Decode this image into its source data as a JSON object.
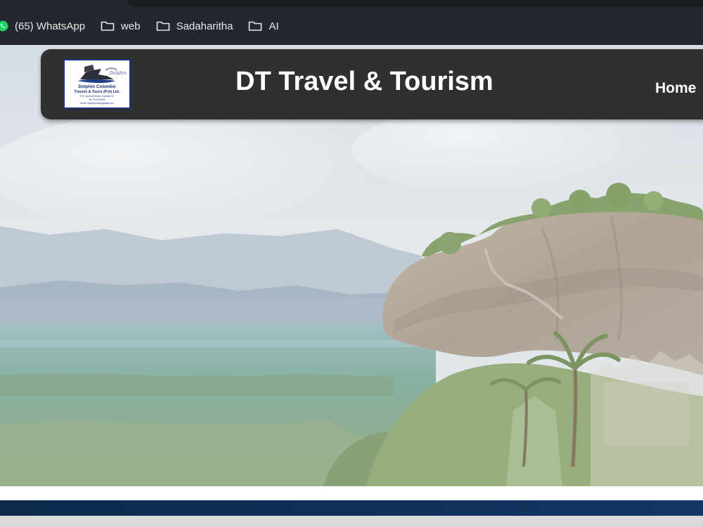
{
  "browser": {
    "bookmarks": [
      {
        "label": "(65) WhatsApp",
        "icon": "whatsapp-icon"
      },
      {
        "label": "web",
        "icon": "folder-icon"
      },
      {
        "label": "Sadaharitha",
        "icon": "folder-icon"
      },
      {
        "label": "AI",
        "icon": "folder-icon"
      }
    ]
  },
  "site": {
    "title": "DT Travel & Tourism",
    "nav": {
      "home_label": "Home"
    },
    "logo": {
      "line1": "Dolphin Colombo",
      "line2": "Travels & Tours (Pvt) Ltd.",
      "line3": "27/2, Vauxhall Street, Colombo 02.",
      "line4": "Tel: 0112302530",
      "line5": "Email: dolphintravels@gmail.com",
      "script": "Dolphin"
    }
  },
  "colors": {
    "browser_bg": "#23272e",
    "navbar_bg": "#262628",
    "navy_band": "#10305a",
    "whatsapp_green": "#25d366"
  }
}
